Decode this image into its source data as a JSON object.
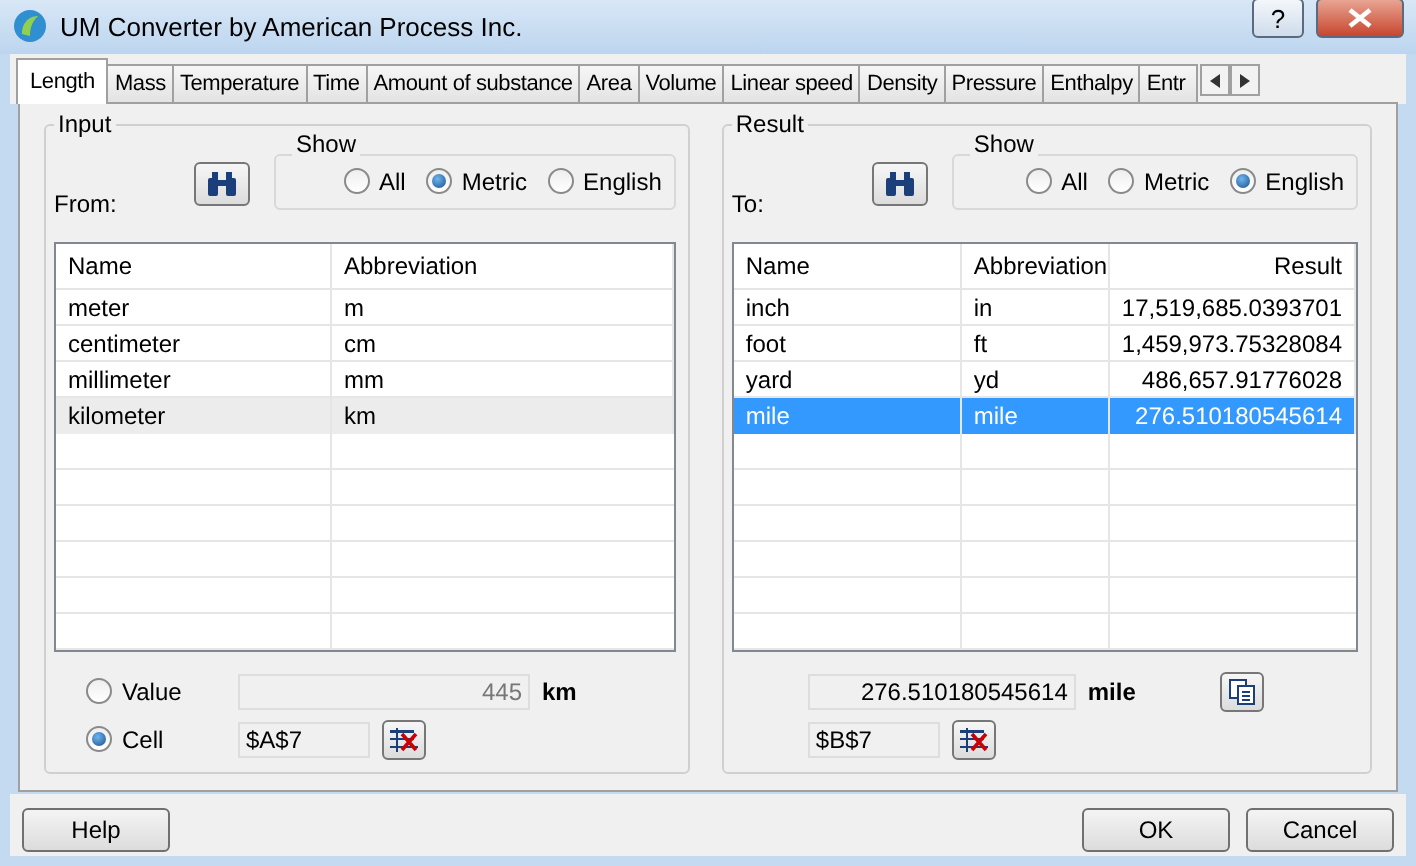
{
  "window": {
    "title": "UM Converter by American Process Inc.",
    "help": "?"
  },
  "tabs": [
    {
      "label": "Length",
      "selected": true
    },
    {
      "label": "Mass",
      "selected": false
    },
    {
      "label": "Temperature",
      "selected": false
    },
    {
      "label": "Time",
      "selected": false
    },
    {
      "label": "Amount of substance",
      "selected": false
    },
    {
      "label": "Area",
      "selected": false
    },
    {
      "label": "Volume",
      "selected": false
    },
    {
      "label": "Linear speed",
      "selected": false
    },
    {
      "label": "Density",
      "selected": false
    },
    {
      "label": "Pressure",
      "selected": false
    },
    {
      "label": "Enthalpy",
      "selected": false
    },
    {
      "label": "Entr",
      "selected": false
    }
  ],
  "input": {
    "title": "Input",
    "label": "From:",
    "show_title": "Show",
    "show": [
      {
        "label": "All",
        "selected": false
      },
      {
        "label": "Metric",
        "selected": true
      },
      {
        "label": "English",
        "selected": false
      }
    ],
    "columns": [
      "Name",
      "Abbreviation"
    ],
    "rows": [
      {
        "name": "meter",
        "abbr": "m",
        "selected": false
      },
      {
        "name": "centimeter",
        "abbr": "cm",
        "selected": false
      },
      {
        "name": "millimeter",
        "abbr": "mm",
        "selected": false
      },
      {
        "name": "kilometer",
        "abbr": "km",
        "selected": true
      }
    ],
    "source": [
      {
        "label": "Value",
        "selected": false,
        "value": "445",
        "unit": "km"
      },
      {
        "label": "Cell",
        "selected": true,
        "value": "$A$7"
      }
    ]
  },
  "result": {
    "title": "Result",
    "label": "To:",
    "show_title": "Show",
    "show": [
      {
        "label": "All",
        "selected": false
      },
      {
        "label": "Metric",
        "selected": false
      },
      {
        "label": "English",
        "selected": true
      }
    ],
    "columns": [
      "Name",
      "Abbreviation",
      "Result"
    ],
    "rows": [
      {
        "name": "inch",
        "abbr": "in",
        "result": "17,519,685.0393701",
        "selected": false
      },
      {
        "name": "foot",
        "abbr": "ft",
        "result": "1,459,973.75328084",
        "selected": false
      },
      {
        "name": "yard",
        "abbr": "yd",
        "result": "486,657.91776028",
        "selected": false
      },
      {
        "name": "mile",
        "abbr": "mile",
        "result": "276.510180545614",
        "selected": true
      }
    ],
    "value": "276.510180545614",
    "unit": "mile",
    "cell": "$B$7"
  },
  "buttons": {
    "help": "Help",
    "ok": "OK",
    "cancel": "Cancel"
  }
}
